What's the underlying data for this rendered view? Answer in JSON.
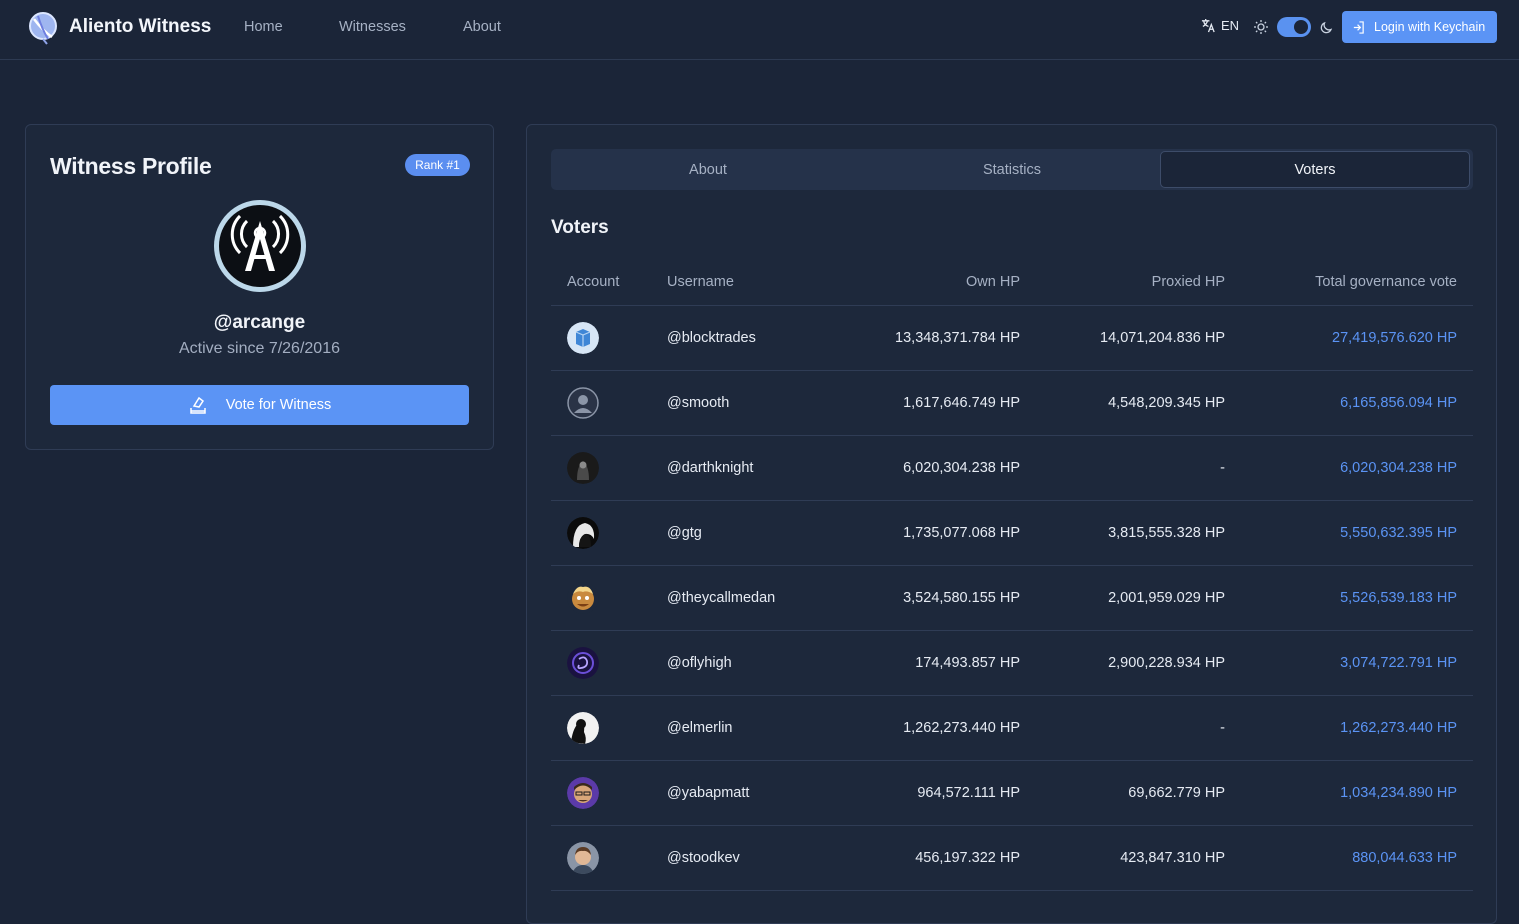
{
  "header": {
    "brand": "Aliento Witness",
    "nav": [
      "Home",
      "Witnesses",
      "About"
    ],
    "language": "EN",
    "theme_dark_enabled": true,
    "login_label": "Login with Keychain"
  },
  "profile": {
    "title": "Witness Profile",
    "rank": "Rank #1",
    "username": "@arcange",
    "active_since": "Active since 7/26/2016",
    "vote_button": "Vote for Witness"
  },
  "tabs": {
    "items": [
      "About",
      "Statistics",
      "Voters"
    ],
    "active": "Voters"
  },
  "voters": {
    "title": "Voters",
    "columns": {
      "account": "Account",
      "username": "Username",
      "own_hp": "Own HP",
      "proxied_hp": "Proxied HP",
      "total": "Total governance vote"
    },
    "rows": [
      {
        "username": "@blocktrades",
        "own": "13,348,371.784 HP",
        "proxied": "14,071,204.836 HP",
        "total": "27,419,576.620 HP",
        "avatar": "blue-cube"
      },
      {
        "username": "@smooth",
        "own": "1,617,646.749 HP",
        "proxied": "4,548,209.345 HP",
        "total": "6,165,856.094 HP",
        "avatar": "default-user"
      },
      {
        "username": "@darthknight",
        "own": "6,020,304.238 HP",
        "proxied": "-",
        "total": "6,020,304.238 HP",
        "avatar": "dark-knight"
      },
      {
        "username": "@gtg",
        "own": "1,735,077.068 HP",
        "proxied": "3,815,555.328 HP",
        "total": "5,550,632.395 HP",
        "avatar": "hooded-figure"
      },
      {
        "username": "@theycallmedan",
        "own": "3,524,580.155 HP",
        "proxied": "2,001,959.029 HP",
        "total": "5,526,539.183 HP",
        "avatar": "cartoon-character"
      },
      {
        "username": "@oflyhigh",
        "own": "174,493.857 HP",
        "proxied": "2,900,228.934 HP",
        "total": "3,074,722.791 HP",
        "avatar": "purple-swirl"
      },
      {
        "username": "@elmerlin",
        "own": "1,262,273.440 HP",
        "proxied": "-",
        "total": "1,262,273.440 HP",
        "avatar": "silhouette"
      },
      {
        "username": "@yabapmatt",
        "own": "964,572.111 HP",
        "proxied": "69,662.779 HP",
        "total": "1,034,234.890 HP",
        "avatar": "person-glasses"
      },
      {
        "username": "@stoodkev",
        "own": "456,197.322 HP",
        "proxied": "423,847.310 HP",
        "total": "880,044.633 HP",
        "avatar": "person-portrait"
      }
    ]
  },
  "colors": {
    "background": "#1b2538",
    "card": "#1d283b",
    "accent": "#5b94f5",
    "border": "#2f3c55",
    "muted_text": "#a6b1c4"
  }
}
